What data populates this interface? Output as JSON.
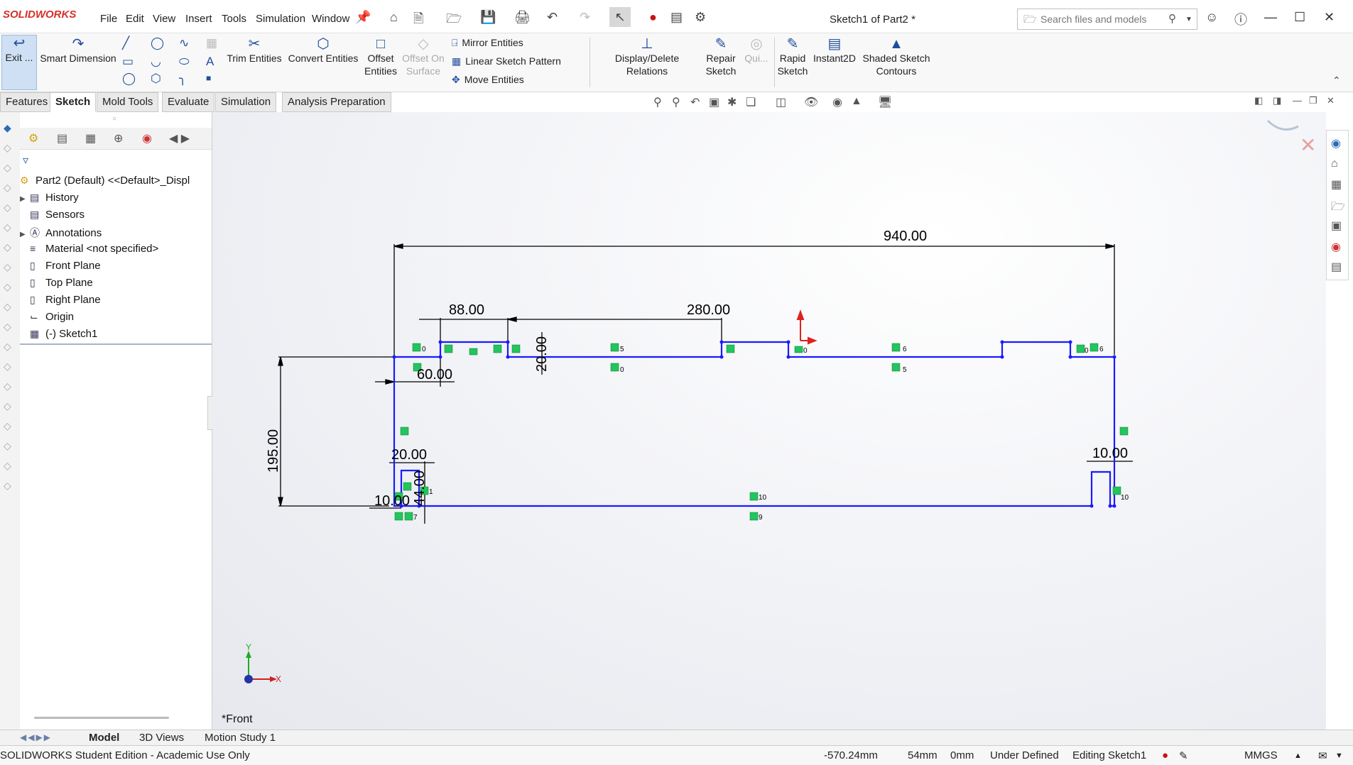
{
  "app": {
    "logo": "SOLIDWORKS",
    "menu": [
      "File",
      "Edit",
      "View",
      "Insert",
      "Tools",
      "Simulation",
      "Window"
    ],
    "document_title": "Sketch1 of Part2 *",
    "search_placeholder": "Search files and models"
  },
  "command_manager": {
    "exit_sketch": "Exit ...",
    "smart_dimension": "Smart Dimension",
    "trim_entities": "Trim Entities",
    "convert_entities": "Convert Entities",
    "offset_entities": "Offset Entities",
    "offset_on_surface": "Offset On Surface",
    "mirror_entities": "Mirror Entities",
    "linear_sketch_pattern": "Linear Sketch Pattern",
    "move_entities": "Move Entities",
    "display_delete_relations": "Display/Delete Relations",
    "repair_sketch": "Repair Sketch",
    "quick_snaps": "Qui...",
    "rapid_sketch": "Rapid Sketch",
    "instant2d": "Instant2D",
    "shaded_sketch_contours": "Shaded Sketch Contours"
  },
  "tabs": [
    "Features",
    "Sketch",
    "Mold Tools",
    "Evaluate",
    "Simulation",
    "Analysis Preparation"
  ],
  "active_tab": "Sketch",
  "feature_tree": {
    "root": "Part2 (Default) <<Default>_Displ",
    "items": [
      {
        "label": "History",
        "icon": "history-icon",
        "expandable": true
      },
      {
        "label": "Sensors",
        "icon": "sensors-icon",
        "expandable": false
      },
      {
        "label": "Annotations",
        "icon": "annotations-icon",
        "expandable": true
      },
      {
        "label": "Material <not specified>",
        "icon": "material-icon",
        "expandable": false
      },
      {
        "label": "Front Plane",
        "icon": "plane-icon",
        "expandable": false
      },
      {
        "label": "Top Plane",
        "icon": "plane-icon",
        "expandable": false
      },
      {
        "label": "Right Plane",
        "icon": "plane-icon",
        "expandable": false
      },
      {
        "label": "Origin",
        "icon": "origin-icon",
        "expandable": false
      },
      {
        "label": "(-) Sketch1",
        "icon": "sketch-icon",
        "expandable": false
      }
    ]
  },
  "sketch": {
    "dimensions": {
      "overall_width": "940.00",
      "left_step": "88.00",
      "mid_span": "280.00",
      "step_height": "20.00",
      "left_offset": "60.00",
      "overall_height": "195.00",
      "foot_width_left": "20.00",
      "foot_height": "44.00",
      "foot_gap_left": "10.00",
      "foot_width_right": "10.00"
    },
    "relation_labels": [
      "0",
      "5",
      "0",
      "6",
      "5",
      "0",
      "6",
      "10",
      "9",
      "1",
      "7",
      "0",
      "10"
    ],
    "axis_x": "X",
    "axis_y": "Y",
    "view_label": "*Front"
  },
  "bottom_tabs": [
    "Model",
    "3D Views",
    "Motion Study 1"
  ],
  "active_bottom_tab": "Model",
  "status": {
    "edition": "SOLIDWORKS Student Edition - Academic Use Only",
    "x": "-570.24mm",
    "y": "54mm",
    "z": "0mm",
    "state": "Under Defined",
    "editing": "Editing Sketch1",
    "units": "MMGS"
  },
  "colors": {
    "sketch_line": "#1a1aff",
    "relation_badge": "#22c55e",
    "dimension": "#000000",
    "logo_red": "#d6302b"
  }
}
